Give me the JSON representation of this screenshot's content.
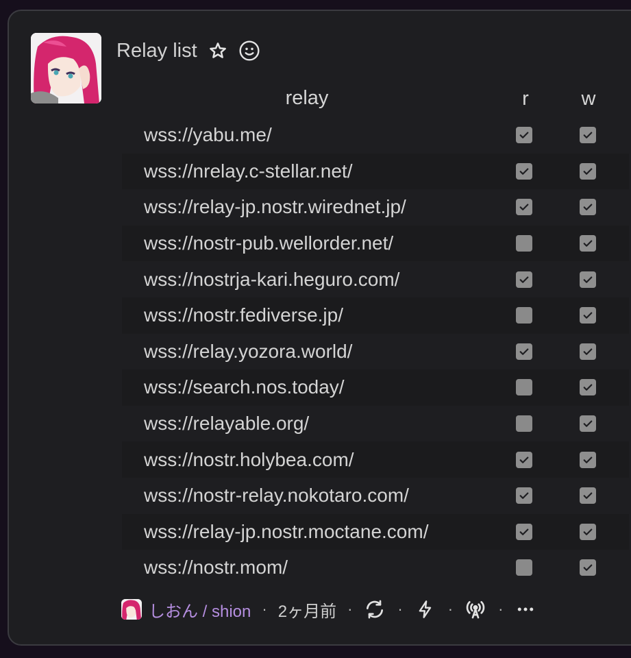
{
  "event": {
    "title": "Relay list",
    "favorite_icon": "star-icon",
    "reaction_icon": "smiley-icon"
  },
  "table": {
    "headers": {
      "relay": "relay",
      "read": "r",
      "write": "w"
    },
    "rows": [
      {
        "url": "wss://yabu.me/",
        "read": true,
        "write": true
      },
      {
        "url": "wss://nrelay.c-stellar.net/",
        "read": true,
        "write": true
      },
      {
        "url": "wss://relay-jp.nostr.wirednet.jp/",
        "read": true,
        "write": true
      },
      {
        "url": "wss://nostr-pub.wellorder.net/",
        "read": false,
        "write": true
      },
      {
        "url": "wss://nostrja-kari.heguro.com/",
        "read": true,
        "write": true
      },
      {
        "url": "wss://nostr.fediverse.jp/",
        "read": false,
        "write": true
      },
      {
        "url": "wss://relay.yozora.world/",
        "read": true,
        "write": true
      },
      {
        "url": "wss://search.nos.today/",
        "read": false,
        "write": true
      },
      {
        "url": "wss://relayable.org/",
        "read": false,
        "write": true
      },
      {
        "url": "wss://nostr.holybea.com/",
        "read": true,
        "write": true
      },
      {
        "url": "wss://nostr-relay.nokotaro.com/",
        "read": true,
        "write": true
      },
      {
        "url": "wss://relay-jp.nostr.moctane.com/",
        "read": true,
        "write": true
      },
      {
        "url": "wss://nostr.mom/",
        "read": false,
        "write": true
      }
    ]
  },
  "footer": {
    "author": "しおん / shion",
    "separator": "·",
    "time": "2ヶ月前",
    "icons": [
      "repost-icon",
      "zap-icon",
      "broadcast-icon",
      "more-icon"
    ]
  },
  "colors": {
    "background": "#160f1c",
    "card": "#1e1e21",
    "author": "#b58ee0",
    "checkbox": "#8f8f8f"
  }
}
